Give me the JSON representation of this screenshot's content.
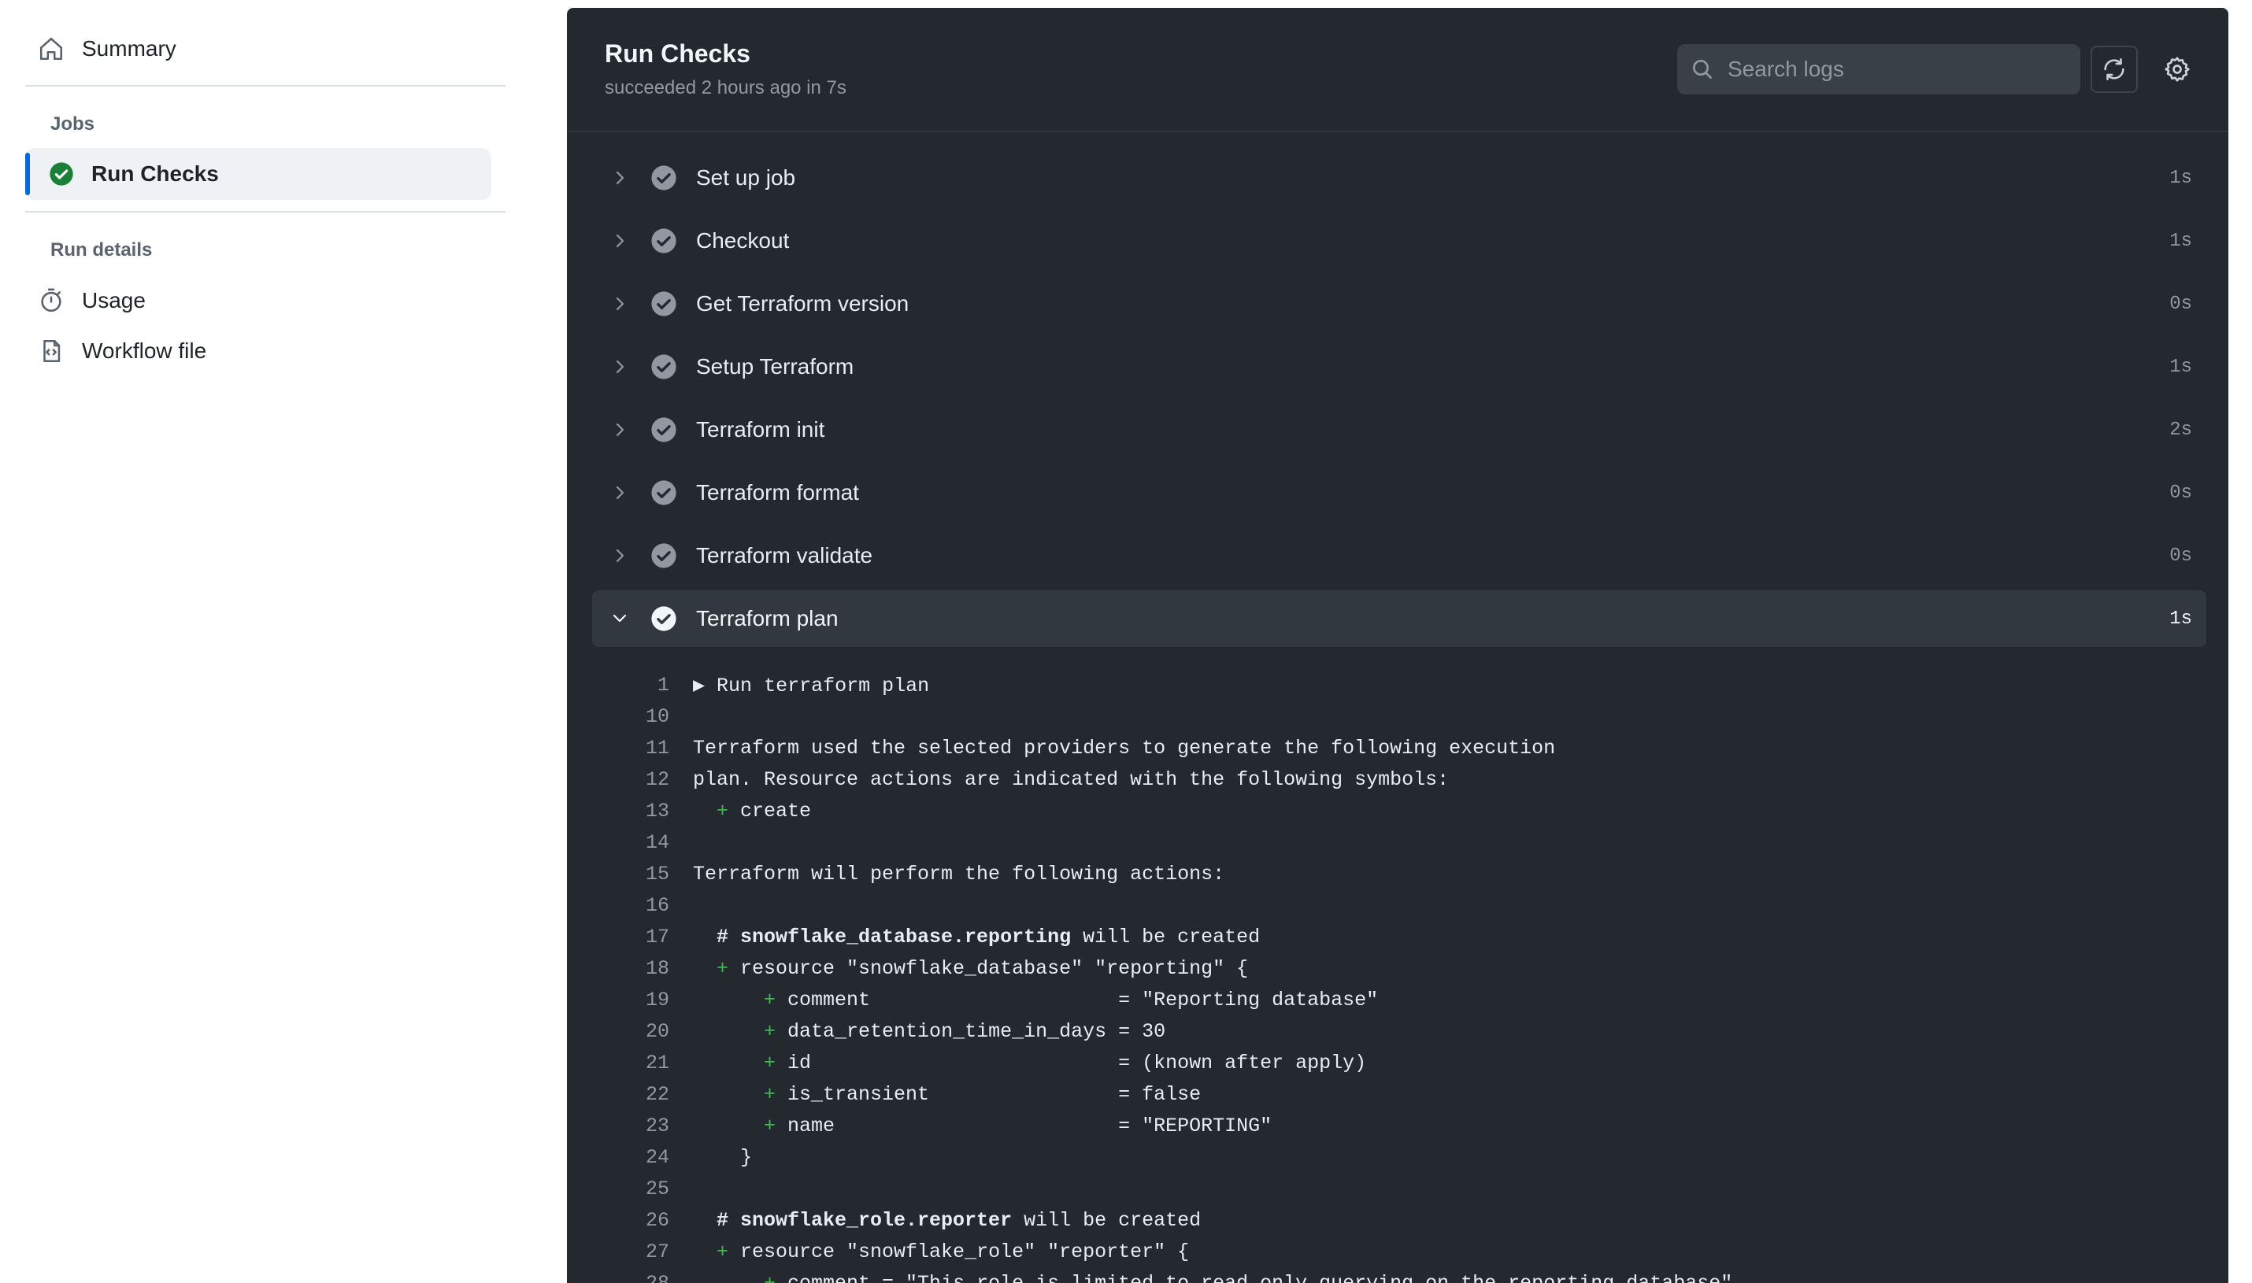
{
  "sidebar": {
    "summary": "Summary",
    "jobs_label": "Jobs",
    "active_job": "Run Checks",
    "run_details_label": "Run details",
    "usage": "Usage",
    "workflow_file": "Workflow file"
  },
  "panel": {
    "title": "Run Checks",
    "status": "succeeded 2 hours ago in 7s",
    "search_placeholder": "Search logs"
  },
  "steps": [
    {
      "name": "Set up job",
      "duration": "1s"
    },
    {
      "name": "Checkout",
      "duration": "1s"
    },
    {
      "name": "Get Terraform version",
      "duration": "0s"
    },
    {
      "name": "Setup Terraform",
      "duration": "1s"
    },
    {
      "name": "Terraform init",
      "duration": "2s"
    },
    {
      "name": "Terraform format",
      "duration": "0s"
    },
    {
      "name": "Terraform validate",
      "duration": "0s"
    },
    {
      "name": "Terraform plan",
      "duration": "1s"
    }
  ],
  "log": [
    {
      "n": "1",
      "t": "▶ Run terraform plan"
    },
    {
      "n": "10",
      "t": ""
    },
    {
      "n": "11",
      "t": "Terraform used the selected providers to generate the following execution"
    },
    {
      "n": "12",
      "t": "plan. Resource actions are indicated with the following symbols:"
    },
    {
      "n": "13",
      "p": "  + ",
      "t": "create"
    },
    {
      "n": "14",
      "t": ""
    },
    {
      "n": "15",
      "t": "Terraform will perform the following actions:"
    },
    {
      "n": "16",
      "t": ""
    },
    {
      "n": "17",
      "b": "  # snowflake_database.reporting",
      "t": " will be created"
    },
    {
      "n": "18",
      "p": "  + ",
      "t": "resource \"snowflake_database\" \"reporting\" {"
    },
    {
      "n": "19",
      "p": "      + ",
      "t": "comment                     = \"Reporting database\""
    },
    {
      "n": "20",
      "p": "      + ",
      "t": "data_retention_time_in_days = 30"
    },
    {
      "n": "21",
      "p": "      + ",
      "t": "id                          = (known after apply)"
    },
    {
      "n": "22",
      "p": "      + ",
      "t": "is_transient                = false"
    },
    {
      "n": "23",
      "p": "      + ",
      "t": "name                        = \"REPORTING\""
    },
    {
      "n": "24",
      "t": "    }"
    },
    {
      "n": "25",
      "t": ""
    },
    {
      "n": "26",
      "b": "  # snowflake_role.reporter",
      "t": " will be created"
    },
    {
      "n": "27",
      "p": "  + ",
      "t": "resource \"snowflake_role\" \"reporter\" {"
    },
    {
      "n": "28",
      "p": "      + ",
      "t": "comment = \"This role is limited to read only querying on the reporting database\""
    }
  ]
}
